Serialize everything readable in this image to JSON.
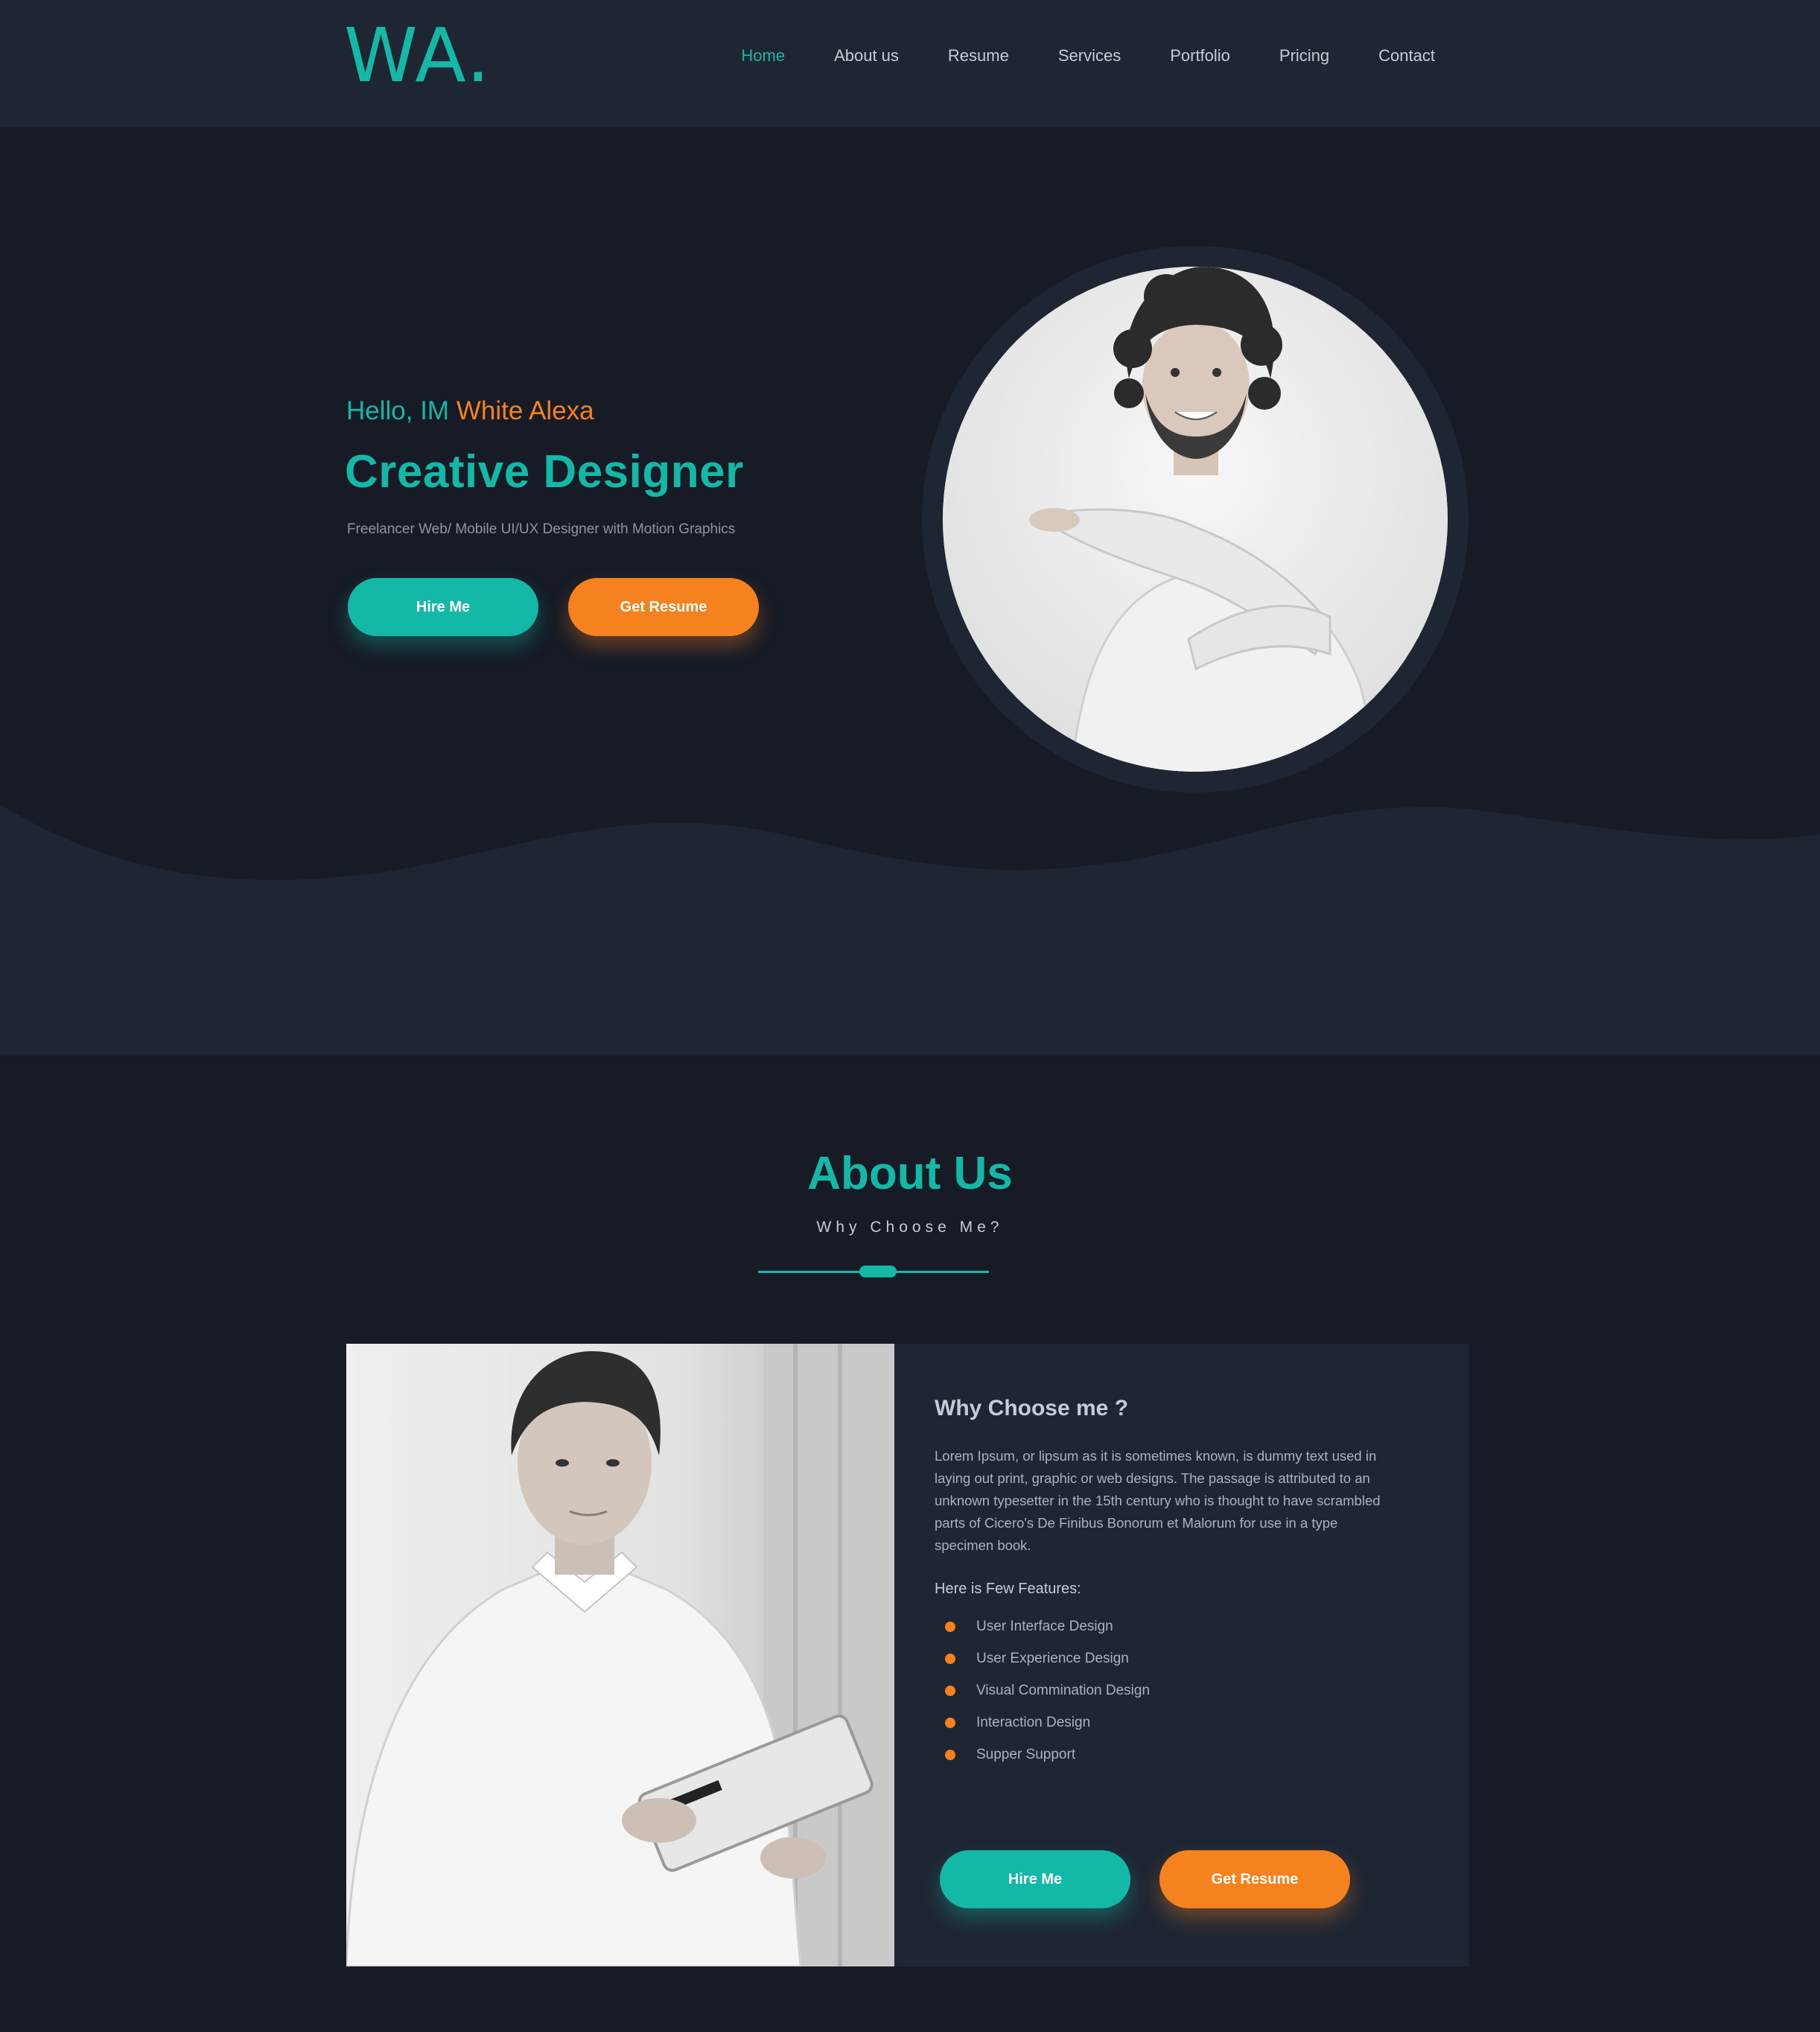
{
  "header": {
    "logo": "WA.",
    "nav": [
      "Home",
      "About us",
      "Resume",
      "Services",
      "Portfolio",
      "Pricing",
      "Contact"
    ],
    "active_index": 0
  },
  "hero": {
    "greeting": "Hello, IM",
    "name": "White Alexa",
    "title": "Creative Designer",
    "subtitle": "Freelancer Web/ Mobile UI/UX Designer with Motion Graphics",
    "hire_label": "Hire Me",
    "resume_label": "Get Resume"
  },
  "about": {
    "title": "About Us",
    "subtitle": "Why Choose Me?",
    "card_title": "Why Choose me ?",
    "body": "Lorem Ipsum, or lipsum as it is sometimes known, is dummy text used in laying out print, graphic or web designs. The passage is attributed to an unknown typesetter in the 15th century who is thought to have scrambled parts of Cicero's De Finibus Bonorum et Malorum for use in a type specimen book.",
    "features_label": "Here is Few Features:",
    "features": [
      "User Interface Design",
      "User Experience Design",
      "Visual  Commination Design",
      "Interaction Design",
      "Supper Support"
    ],
    "hire_label": "Hire Me",
    "resume_label": "Get Resume"
  },
  "colors": {
    "accent": "#14b8a6",
    "highlight": "#f5821f",
    "background": "#161b26",
    "panel": "#1e2633"
  }
}
